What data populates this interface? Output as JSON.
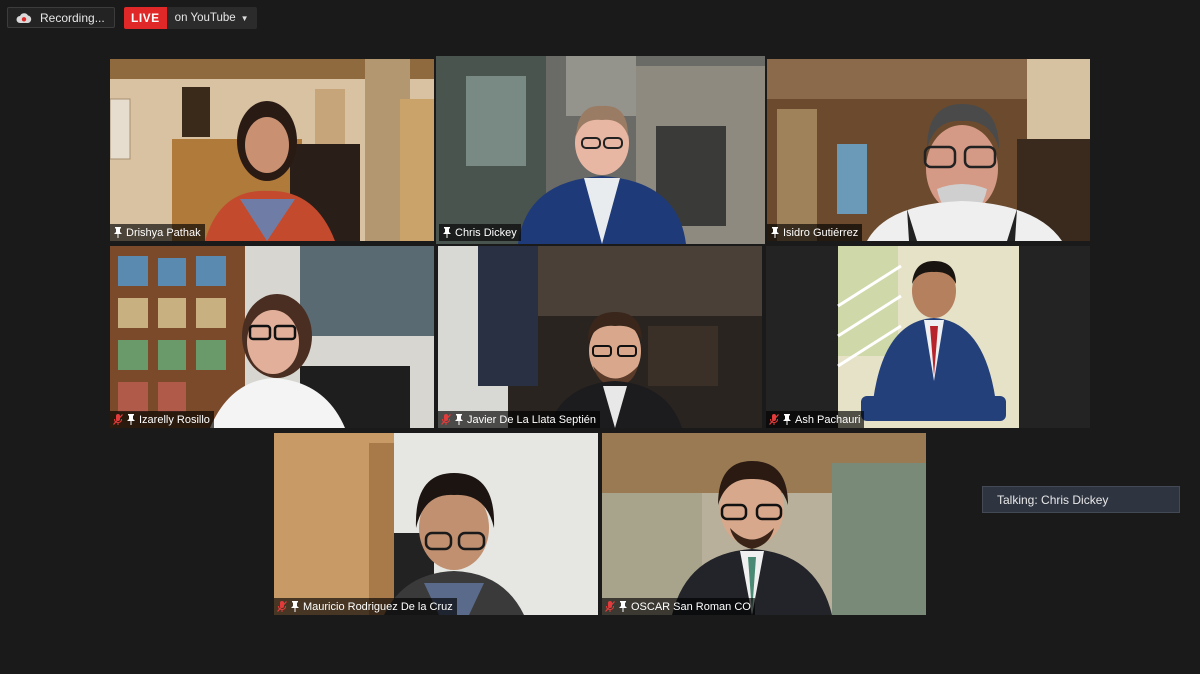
{
  "topbar": {
    "recording_label": "Recording...",
    "live_badge": "LIVE",
    "live_destination": "on YouTube"
  },
  "participants": [
    {
      "name": "Drishya Pathak",
      "muted": false,
      "active": false
    },
    {
      "name": "Chris Dickey",
      "muted": false,
      "active": true
    },
    {
      "name": "Isidro Gutiérrez",
      "muted": false,
      "active": false
    },
    {
      "name": "Izarelly Rosillo",
      "muted": true,
      "active": false
    },
    {
      "name": "Javier De La Llata Septién",
      "muted": true,
      "active": false
    },
    {
      "name": "Ash Pachauri",
      "muted": true,
      "active": false
    },
    {
      "name": "Mauricio Rodriguez De la Cruz",
      "muted": true,
      "active": false
    },
    {
      "name": "OSCAR San Roman CO",
      "muted": true,
      "active": false
    }
  ],
  "talking_indicator": "Talking: Chris Dickey",
  "colors": {
    "background": "#1a1a1a",
    "live_red": "#e02828",
    "active_speaker_border": "#c9e66a",
    "muted_icon": "#e23b3b"
  },
  "icons": [
    "cloud-record-icon",
    "caret-down-icon",
    "pin-icon",
    "mic-muted-icon"
  ]
}
